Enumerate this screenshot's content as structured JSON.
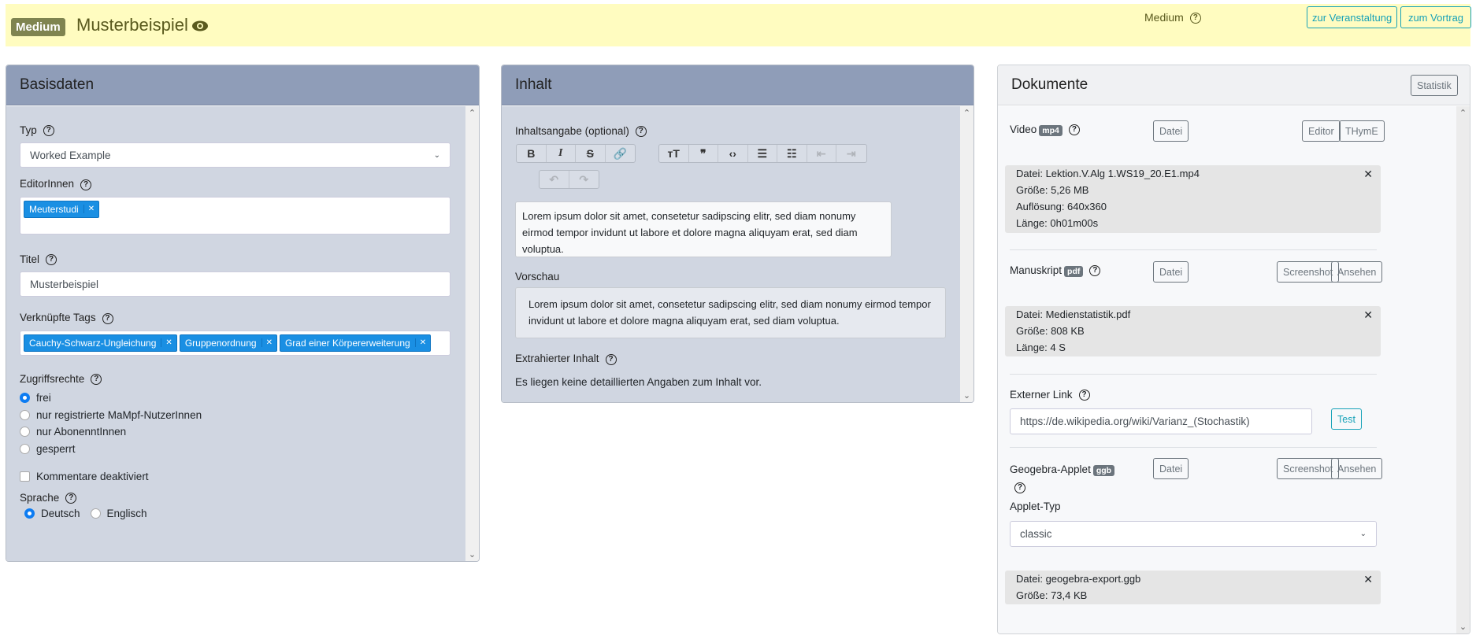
{
  "header": {
    "badge": "Medium",
    "title": "Musterbeispiel",
    "medium_label": "Medium",
    "btn_event": "zur Veranstaltung",
    "btn_talk": "zum Vortrag"
  },
  "basis": {
    "title": "Basisdaten",
    "typ_label": "Typ",
    "typ_value": "Worked Example",
    "editors_label": "EditorInnen",
    "editors": [
      "Meuterstudi"
    ],
    "titel_label": "Titel",
    "titel_value": "Musterbeispiel",
    "tags_label": "Verknüpfte Tags",
    "tags": [
      "Cauchy-Schwarz-Ungleichung",
      "Gruppenordnung",
      "Grad einer Körpererweiterung"
    ],
    "access_label": "Zugriffsrechte",
    "access_options": [
      "frei",
      "nur registrierte MaMpf-NutzerInnen",
      "nur AbonenntInnen",
      "gesperrt"
    ],
    "access_selected": "frei",
    "comments_label": "Kommentare deaktiviert",
    "comments_checked": false,
    "lang_label": "Sprache",
    "lang_options": [
      "Deutsch",
      "Englisch"
    ],
    "lang_selected": "Deutsch"
  },
  "inhalt": {
    "title": "Inhalt",
    "summary_label": "Inhaltsangabe (optional)",
    "summary_text": "Lorem ipsum dolor sit amet, consetetur sadipscing elitr, sed diam nonumy eirmod tempor invidunt ut labore et dolore magna aliquyam erat, sed diam voluptua.",
    "preview_label": "Vorschau",
    "preview_text": "Lorem ipsum dolor sit amet, consetetur sadipscing elitr, sed diam nonumy eirmod tempor invidunt ut labore et dolore magna aliquyam erat, sed diam voluptua.",
    "extracted_label": "Extrahierter Inhalt",
    "extracted_text": "Es liegen keine detaillierten Angaben zum Inhalt vor."
  },
  "docs": {
    "title": "Dokumente",
    "stats_btn": "Statistik",
    "video": {
      "label": "Video",
      "type": "mp4",
      "file_btn": "Datei",
      "editor_btn": "Editor",
      "thyme_btn": "THymE",
      "lines": [
        "Datei: Lektion.V.Alg 1.WS19_20.E1.mp4",
        "Größe: 5,26 MB",
        "Auflösung: 640x360",
        "Länge: 0h01m00s"
      ]
    },
    "manuscript": {
      "label": "Manuskript",
      "type": "pdf",
      "file_btn": "Datei",
      "screenshot_btn": "Screenshot",
      "view_btn": "Ansehen",
      "lines": [
        "Datei: Medienstatistik.pdf",
        "Größe: 808 KB",
        "Länge: 4 S"
      ]
    },
    "link": {
      "label": "Externer Link",
      "value": "https://de.wikipedia.org/wiki/Varianz_(Stochastik)",
      "test_btn": "Test"
    },
    "geogebra": {
      "label": "Geogebra-Applet",
      "type": "ggb",
      "file_btn": "Datei",
      "screenshot_btn": "Screenshot",
      "view_btn": "Ansehen",
      "applet_type_label": "Applet-Typ",
      "applet_type_value": "classic",
      "lines": [
        "Datei: geogebra-export.ggb",
        "Größe: 73,4 KB"
      ]
    }
  },
  "colors": {
    "topbar": "#fffcc0",
    "panel_header": "#8f9db8",
    "panel_body": "#d0d6e1",
    "chip": "#1a8fe3",
    "info_btn": "#17a2b8"
  }
}
